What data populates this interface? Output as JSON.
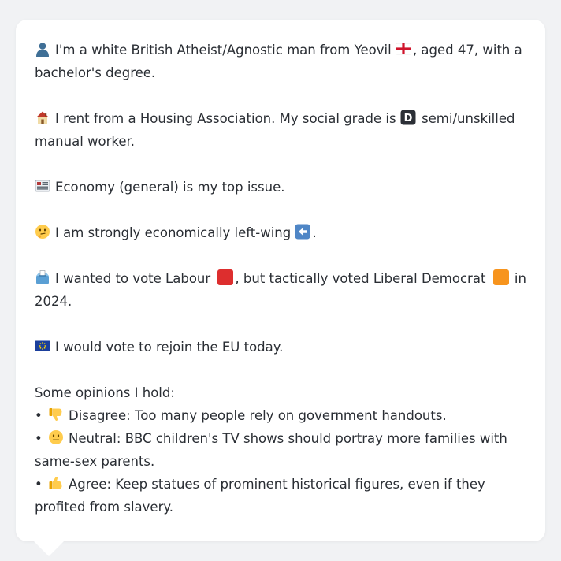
{
  "profile": {
    "identity": {
      "icon": "person-silhouette-icon",
      "text_before_flag": "I'm a white British Atheist/Agnostic man from Yeovil",
      "flag_icon": "england-flag-icon",
      "text_after_flag": ", aged 47, with a bachelor's degree."
    },
    "housing": {
      "icon": "house-icon",
      "text_before_grade": "I rent from a Housing Association. My social grade is",
      "grade_icon": "letter-d-icon",
      "grade_letter": "D",
      "text_after_grade": "semi/unskilled manual worker."
    },
    "issue": {
      "icon": "newspaper-icon",
      "text": "Economy (general) is my top issue."
    },
    "economics": {
      "icon": "thinking-face-icon",
      "text": "I am strongly economically left-wing",
      "arrow_icon": "left-arrow-icon",
      "text_after_arrow": "."
    },
    "vote": {
      "icon": "ballot-box-icon",
      "text_1": "I wanted to vote Labour",
      "labour_color": "#dd2e2e",
      "text_2": ", but tactically voted Liberal Democrat",
      "libdem_color": "#f7941d",
      "text_3": "in 2024."
    },
    "eu": {
      "icon": "eu-flag-icon",
      "text": "I would vote to rejoin the EU today."
    },
    "opinions": {
      "heading": "Some opinions I hold:",
      "bullet": "•",
      "items": [
        {
          "icon": "thumbs-down-icon",
          "stance": "Disagree:",
          "text": "Too many people rely on government handouts."
        },
        {
          "icon": "neutral-face-icon",
          "stance": "Neutral:",
          "text": "BBC children's TV shows should portray more families with same-sex parents."
        },
        {
          "icon": "thumbs-up-icon",
          "stance": "Agree:",
          "text": "Keep statues of prominent historical figures, even if they profited from slavery."
        }
      ]
    }
  }
}
